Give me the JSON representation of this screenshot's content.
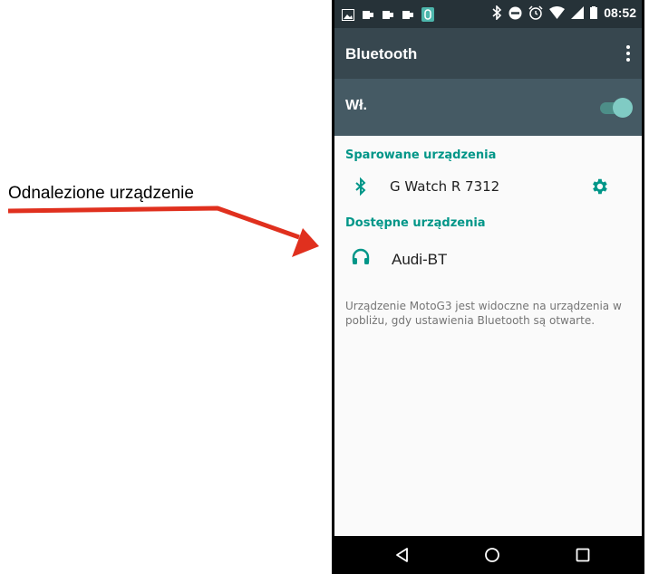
{
  "annotation": {
    "label": "Odnalezione urządzenie"
  },
  "status_bar": {
    "time": "08:52"
  },
  "app_bar": {
    "title": "Bluetooth"
  },
  "master_switch": {
    "label": "Wł.",
    "state": "on"
  },
  "paired": {
    "header": "Sparowane urządzenia",
    "devices": [
      {
        "name": "G Watch R 7312",
        "icon": "bluetooth-icon"
      }
    ]
  },
  "available": {
    "header": "Dostępne urządzenia",
    "devices": [
      {
        "name": "Audi-BT",
        "icon": "headphones-icon"
      }
    ]
  },
  "visibility_note": "Urządzenie MotoG3 jest widoczne na urządzenia w pobliżu, gdy ustawienia Bluetooth są otwarte.",
  "colors": {
    "status_bar": "#263238",
    "app_bar": "#37474f",
    "switch_row": "#455a64",
    "accent": "#009688",
    "annotation_arrow": "#e0301e"
  }
}
